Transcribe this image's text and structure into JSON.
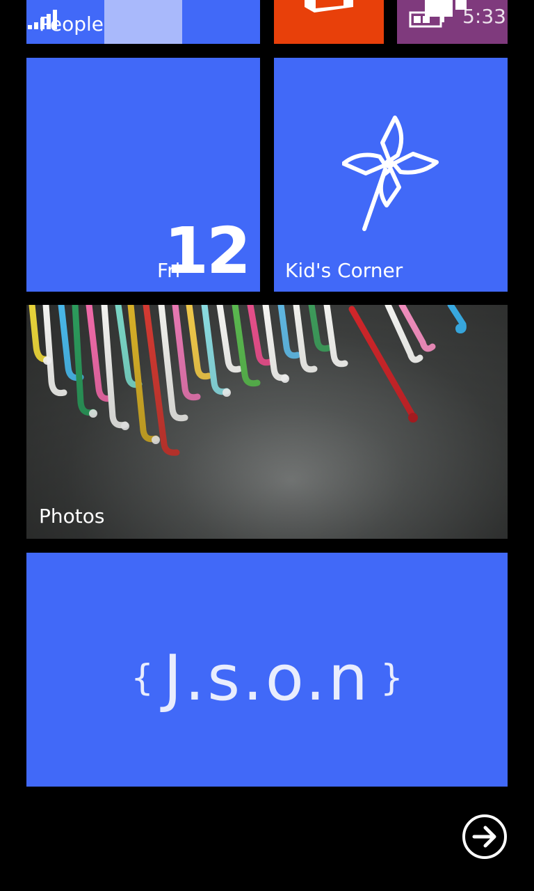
{
  "status_bar": {
    "time": "5:33",
    "icons": [
      "signal-icon",
      "battery-icon"
    ]
  },
  "tiles": {
    "people": {
      "label": "People",
      "color": "#4169f8"
    },
    "office": {
      "color": "#e8400a",
      "icon": "office-icon"
    },
    "media": {
      "color": "#7f3a7d",
      "icon": "media-icon"
    },
    "calendar": {
      "day": "Fri",
      "date": "12",
      "color": "#4169f8"
    },
    "kids_corner": {
      "label": "Kid's Corner",
      "icon": "pinwheel-icon",
      "color": "#4169f8"
    },
    "photos": {
      "label": "Photos"
    },
    "json_app": {
      "brace_open": "{",
      "name": "J.s.o.n",
      "brace_close": "}",
      "color": "#4169f8"
    }
  },
  "navigation": {
    "all_apps_icon": "arrow-right-circle-icon"
  }
}
